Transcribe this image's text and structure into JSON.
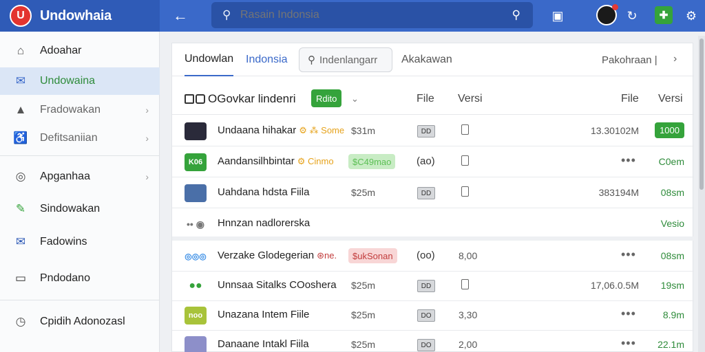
{
  "app": {
    "title": "Undowhaia",
    "logo_glyph": "U"
  },
  "search": {
    "placeholder": "Rasain Indonsia",
    "value": ""
  },
  "sidebar": {
    "items": [
      {
        "label": "Adoahar",
        "icon": "home-icon",
        "glyph": "⌂"
      },
      {
        "label": "Undowaina",
        "icon": "mail-icon",
        "glyph": "✉"
      },
      {
        "label": "Fradowakan",
        "icon": "chart-icon",
        "glyph": "▲"
      },
      {
        "label": "Defitsaniian",
        "icon": "accessibility-icon",
        "glyph": "♿"
      },
      {
        "label": "Apganhaa",
        "icon": "globe-icon",
        "glyph": "◎"
      },
      {
        "label": "Sindowakan",
        "icon": "edit-icon",
        "glyph": "✎"
      },
      {
        "label": "Fadowins",
        "icon": "mail-open-icon",
        "glyph": "✉"
      },
      {
        "label": "Pndodano",
        "icon": "document-icon",
        "glyph": "▭"
      },
      {
        "label": "Cpidih Adonozasl",
        "icon": "clock-icon",
        "glyph": "◷"
      }
    ]
  },
  "tabs": {
    "items": [
      "Undowlan",
      "Indonsia"
    ],
    "search_placeholder": "Indenlangarr",
    "extra": "Akakawan",
    "right_label": "Pakohraan |"
  },
  "table": {
    "group_title": "OGovkar lindenri",
    "group_badge": "Rdito",
    "columns": {
      "file_a": "File",
      "versi_a": "Versi",
      "file_b": "File",
      "versi_b": "Versi"
    },
    "rows": [
      {
        "name": "Undaana hihakar",
        "sym": "⚙ ⁂ Some",
        "size": "$31m",
        "box": "DD",
        "ver": "",
        "file": "13.30102M",
        "stat": "1000",
        "thumb": "#2a2a3a"
      },
      {
        "name": "Aandansilhbintar",
        "sym": "⚙ Cinmo",
        "pill": "$C49mao",
        "pill_class": "green",
        "paren": "(ao)",
        "ver": "",
        "file": "•••",
        "stat": "C0em",
        "thumb": "#35a33b",
        "thumb_text": "K06"
      },
      {
        "name": "Uahdana hdsta Fiila",
        "sym": "",
        "size": "$25m",
        "box": "DD",
        "ver": "",
        "file": "383194M",
        "stat": "08sm",
        "thumb": "#4a6fa8"
      },
      {
        "name": "Hnnzan nadlorerska",
        "sym": "",
        "stat": "Vesio",
        "thumb": ""
      },
      {
        "name": "Verzake Glodegerian",
        "sym": "⊛ne.",
        "pill": "$ukSonan",
        "pill_class": "red",
        "paren": "(oo)",
        "ver": "8,00",
        "file": "•••",
        "stat": "08sm",
        "thumb": ""
      },
      {
        "name": "Unnsaa Sitalks COoshera",
        "sym": "",
        "size": "$25m",
        "box": "DD",
        "ver": "",
        "file": "17,06.0.5M",
        "stat": "19sm",
        "thumb": ""
      },
      {
        "name": "Unazana Intem Fiile",
        "sym": "",
        "size": "$25m",
        "box": "DO",
        "ver": "3,30",
        "file": "•••",
        "stat": "8.9m",
        "thumb": "#a8c33a",
        "thumb_text": "noo"
      },
      {
        "name": "Danaane Intakl Fiila",
        "sym": "",
        "size": "$25m",
        "box": "DO",
        "ver": "2,00",
        "file": "•••",
        "stat": "22.1m",
        "thumb": "#8d8fc9"
      }
    ]
  },
  "colors": {
    "topbar": "#3a69c9",
    "accent_green": "#35a33b",
    "active_nav": "#dbe6f6"
  }
}
